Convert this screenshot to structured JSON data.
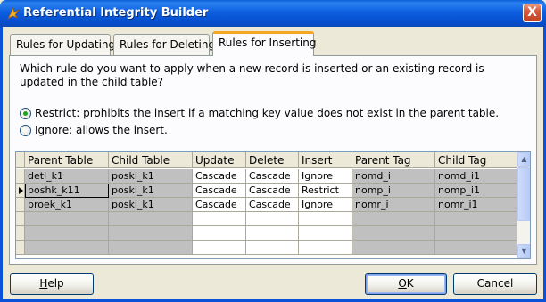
{
  "window": {
    "title": "Referential Integrity Builder",
    "close_glyph": "X"
  },
  "tabs": [
    {
      "label": "Rules for Updating",
      "active": false
    },
    {
      "label": "Rules for Deleting",
      "active": false
    },
    {
      "label": "Rules for Inserting",
      "active": true
    }
  ],
  "question": "Which rule do you want to apply when a new record is inserted or an existing record is updated in the child table?",
  "options": {
    "restrict": {
      "mnemonic": "R",
      "label": "estrict: prohibits the insert if a matching key value does not exist in the parent table.",
      "selected": true
    },
    "ignore": {
      "mnemonic": "I",
      "label": "gnore: allows the insert.",
      "selected": false
    }
  },
  "grid": {
    "columns": [
      "Parent Table",
      "Child Table",
      "Update",
      "Delete",
      "Insert",
      "Parent Tag",
      "Child Tag"
    ],
    "rows": [
      [
        "detl_k1",
        "poski_k1",
        "Cascade",
        "Cascade",
        "Ignore",
        "nomd_i",
        "nomd_i1"
      ],
      [
        "poshk_k11",
        "poski_k1",
        "Cascade",
        "Cascade",
        "Restrict",
        "nomp_i",
        "nomp_i1"
      ],
      [
        "proek_k1",
        "poski_k1",
        "Cascade",
        "Cascade",
        "Ignore",
        "nomr_i",
        "nomr_i1"
      ]
    ],
    "current_row": 1
  },
  "buttons": {
    "help": {
      "mnemonic": "H",
      "rest": "elp"
    },
    "ok": {
      "mnemonic": "O",
      "rest": "K"
    },
    "cancel": {
      "label": "Cancel"
    }
  },
  "colors": {
    "title_bar": "#0a5fd8",
    "tab_accent": "#f5a623",
    "radio_dot": "#21a121",
    "locked_cell": "#c0c0c0"
  }
}
